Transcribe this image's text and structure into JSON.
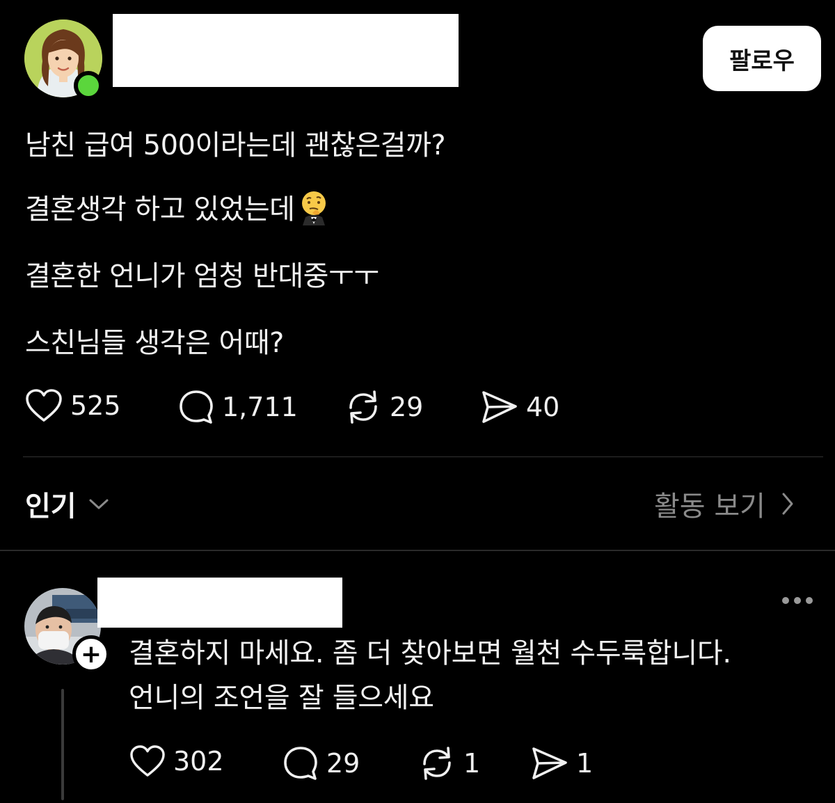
{
  "post": {
    "follow_label": "팔로우",
    "lines": [
      "남친 급여 500이라는데 괜찮은걸까?",
      "결혼생각 하고 있었는데",
      "결혼한 언니가 엄청 반대중ㅜㅜ",
      "스친님들 생각은 어때?"
    ],
    "emoji_icon": "thinking-face-tuxedo-icon",
    "stats": {
      "likes": "525",
      "comments": "1,711",
      "reposts": "29",
      "shares": "40"
    }
  },
  "sort": {
    "label": "인기",
    "activity_label": "활동 보기"
  },
  "reply": {
    "lines": [
      "결혼하지 마세요. 좀 더 찾아보면 월천 수두룩합니다.",
      "언니의 조언을 잘 들으세요"
    ],
    "stats": {
      "likes": "302",
      "comments": "29",
      "reposts": "1",
      "shares": "1"
    }
  },
  "colors": {
    "background": "#000000",
    "text": "#f2f2f2",
    "muted": "#8a8a8a",
    "online": "#5bd63c"
  }
}
